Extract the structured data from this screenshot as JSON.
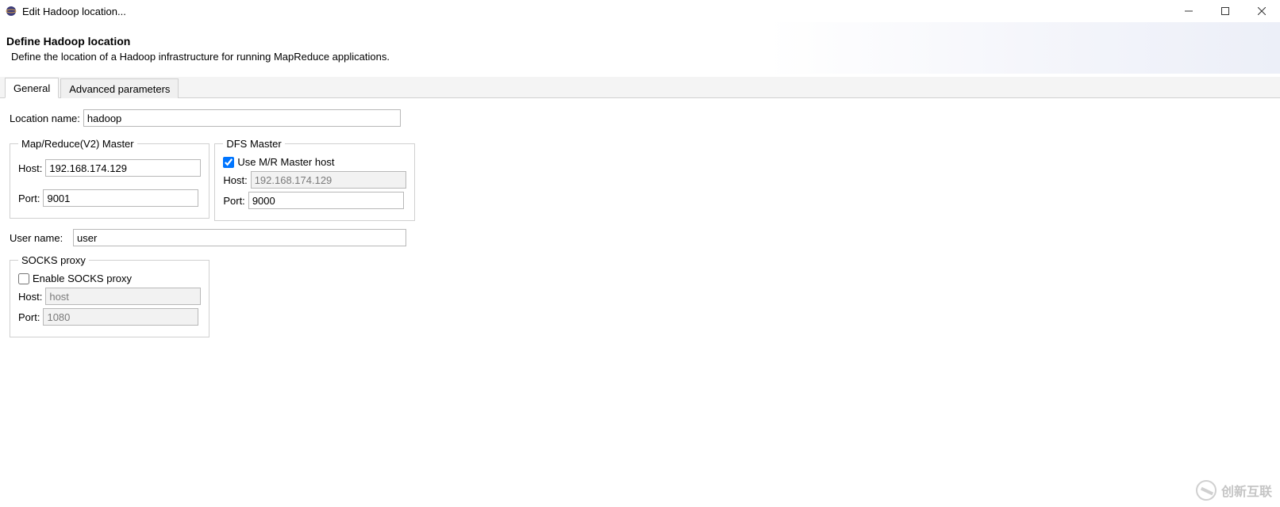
{
  "window": {
    "title": "Edit Hadoop location..."
  },
  "header": {
    "title": "Define Hadoop location",
    "description": "Define the location of a Hadoop infrastructure for running MapReduce applications."
  },
  "tabs": {
    "general": "General",
    "advanced": "Advanced parameters"
  },
  "form": {
    "location_label": "Location name:",
    "location_value": "hadoop",
    "mr_group_title": "Map/Reduce(V2) Master",
    "mr_host_label": "Host:",
    "mr_host_value": "192.168.174.129",
    "mr_port_label": "Port:",
    "mr_port_value": "9001",
    "dfs_group_title": "DFS Master",
    "dfs_use_mr_label": "Use M/R Master host",
    "dfs_use_mr_checked": true,
    "dfs_host_label": "Host:",
    "dfs_host_value": "192.168.174.129",
    "dfs_port_label": "Port:",
    "dfs_port_value": "9000",
    "user_label": "User name:",
    "user_value": "user",
    "socks_group_title": "SOCKS proxy",
    "socks_enable_label": "Enable SOCKS proxy",
    "socks_enable_checked": false,
    "socks_host_label": "Host:",
    "socks_host_value": "host",
    "socks_port_label": "Port:",
    "socks_port_value": "1080"
  },
  "watermark": "创新互联"
}
